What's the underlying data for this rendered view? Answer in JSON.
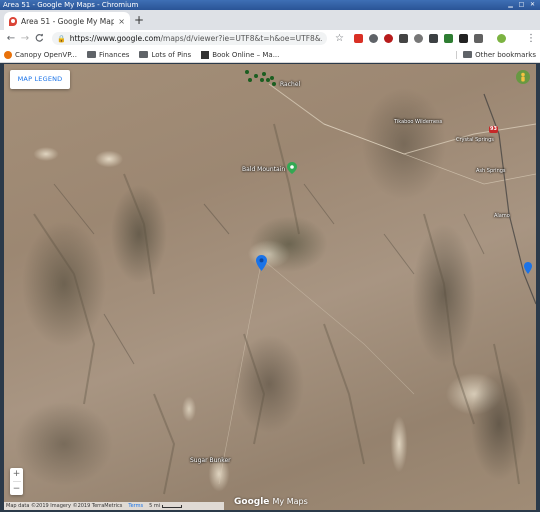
{
  "window": {
    "title": "Area 51 - Google My Maps - Chromium"
  },
  "tab": {
    "title": "Area 51 - Google My Maps",
    "close": "×"
  },
  "toolbar": {
    "back": "←",
    "forward": "→",
    "reload": "C",
    "url_host": "https://www.google.com",
    "url_path": "/maps/d/viewer?ie=UTF8&t=h&oe=UTF8&...",
    "star": "☆",
    "menu": "⋮"
  },
  "bookmarks": {
    "items": [
      {
        "label": "Canopy OpenVP...",
        "icon": "orange-circle-icon"
      },
      {
        "label": "Finances",
        "icon": "folder-icon"
      },
      {
        "label": "Lots of Pins",
        "icon": "folder-icon"
      },
      {
        "label": "Book Online – Ma...",
        "icon": "book-icon"
      }
    ],
    "other": "Other bookmarks"
  },
  "map": {
    "legend_button": "MAP LEGEND",
    "labels": {
      "rachel": "Rachel",
      "wilderness": "Tikaboo Wilderness",
      "crystal_springs": "Crystal Springs",
      "ash_springs": "Ash Springs",
      "alamo": "Alamo",
      "bald_mountain": "Bald Mountain",
      "sugar_bunker": "Sugar Bunker"
    },
    "highway": "93",
    "zoom_in": "+",
    "zoom_out": "−",
    "attribution": {
      "data": "Map data ©2019 Imagery ©2019 TerraMetrics",
      "terms": "Terms",
      "scale": "5 mi"
    },
    "logo": {
      "google": "Google",
      "product": "My Maps"
    },
    "colors": {
      "pin_blue": "#1a73e8",
      "pin_green": "#34a853",
      "hwy_red": "#c62828"
    }
  }
}
